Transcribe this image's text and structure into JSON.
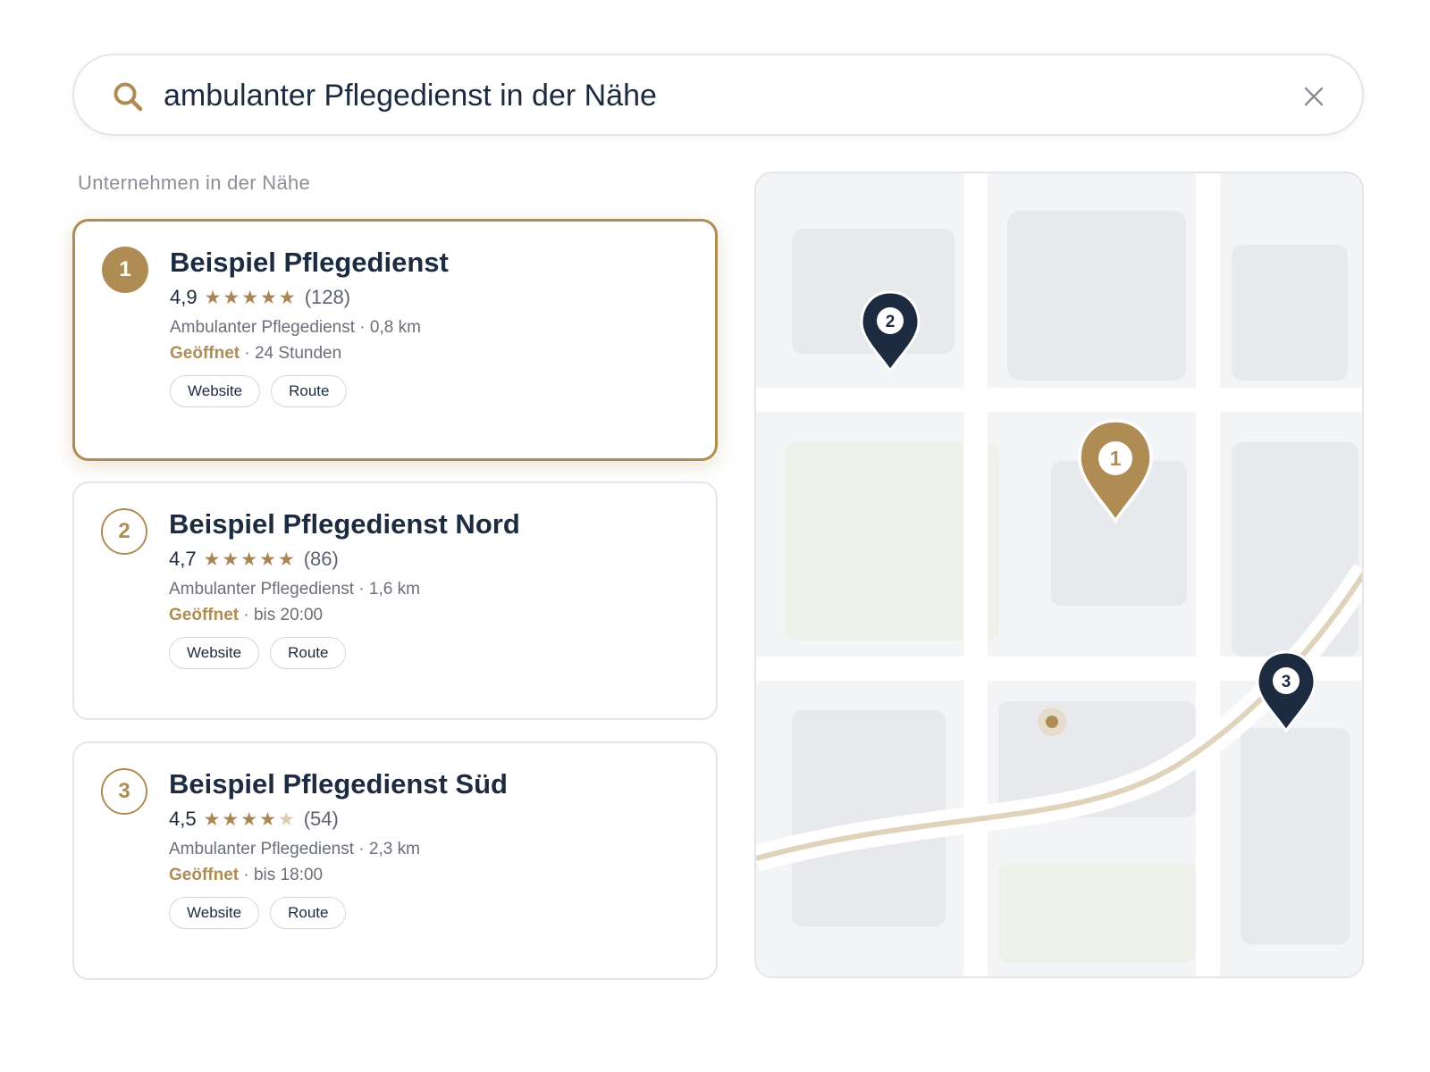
{
  "search": {
    "query": "ambulanter Pflegedienst in der Nähe",
    "icon": "search-icon",
    "clear_icon": "close-icon"
  },
  "section_title": "Unternehmen in der Nähe",
  "results": [
    {
      "number": "1",
      "name": "Beispiel Pflegedienst",
      "rating": "4,9",
      "stars": 5,
      "reviews": "(128)",
      "meta": "Ambulanter Pflegedienst · 0,8 km",
      "status": "Geöffnet",
      "hours": " · 24 Stunden",
      "website_label": "Website",
      "route_label": "Route",
      "selected": true
    },
    {
      "number": "2",
      "name": "Beispiel Pflegedienst Nord",
      "rating": "4,7",
      "stars": 5,
      "reviews": "(86)",
      "meta": "Ambulanter Pflegedienst · 1,6 km",
      "status": "Geöffnet",
      "hours": " · bis 20:00",
      "website_label": "Website",
      "route_label": "Route",
      "selected": false
    },
    {
      "number": "3",
      "name": "Beispiel Pflegedienst Süd",
      "rating": "4,5",
      "stars": 4,
      "reviews": "(54)",
      "meta": "Ambulanter Pflegedienst · 2,3 km",
      "status": "Geöffnet",
      "hours": " · bis 18:00",
      "website_label": "Website",
      "route_label": "Route",
      "selected": false
    }
  ],
  "map": {
    "pins": [
      {
        "label": "1",
        "selected": true
      },
      {
        "label": "2",
        "selected": false
      },
      {
        "label": "3",
        "selected": false
      }
    ]
  },
  "colors": {
    "accent": "#b08c55",
    "navy": "#1c2b40",
    "muted_text": "#6a6f78",
    "border": "#e4e5e8"
  }
}
